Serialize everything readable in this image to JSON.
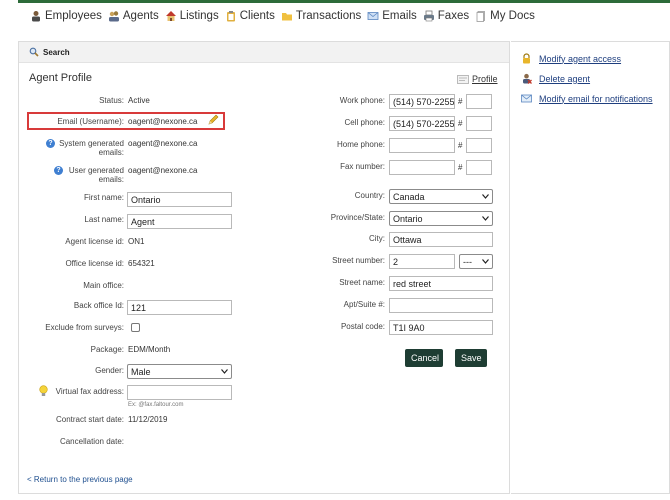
{
  "nav": {
    "items": [
      {
        "label": "Employees",
        "icon": "person-icon"
      },
      {
        "label": "Agents",
        "icon": "agents-icon"
      },
      {
        "label": "Listings",
        "icon": "house-icon"
      },
      {
        "label": "Clients",
        "icon": "clipboard-icon"
      },
      {
        "label": "Transactions",
        "icon": "folder-icon"
      },
      {
        "label": "Emails",
        "icon": "envelope-icon"
      },
      {
        "label": "Faxes",
        "icon": "fax-icon"
      },
      {
        "label": "My Docs",
        "icon": "document-icon"
      }
    ]
  },
  "search": {
    "label": "Search"
  },
  "profile": {
    "title": "Agent Profile",
    "profile_link": "Profile",
    "status_label": "Status:",
    "status_value": "Active",
    "email_label": "Email (Username):",
    "email_value": "oagent@nexone.ca",
    "sys_email_label": "System generated emails:",
    "sys_email_value": "oagent@nexone.ca",
    "user_email_label": "User generated emails:",
    "user_email_value": "oagent@nexone.ca",
    "first_name_label": "First name:",
    "first_name_value": "Ontario",
    "last_name_label": "Last name:",
    "last_name_value": "Agent",
    "agent_license_label": "Agent license id:",
    "agent_license_value": "ON1",
    "office_license_label": "Office license id:",
    "office_license_value": "654321",
    "main_office_label": "Main office:",
    "back_office_label": "Back office Id:",
    "back_office_value": "121",
    "exclude_label": "Exclude from surveys:",
    "package_label": "Package:",
    "package_value": "EDM/Month",
    "gender_label": "Gender:",
    "gender_value": "Male",
    "vfax_label": "Virtual fax address:",
    "vfax_value": "",
    "vfax_hint": "Ex: @fax.faltour.com",
    "contract_label": "Contract start date:",
    "contract_value": "11/12/2019",
    "cancel_date_label": "Cancellation date:"
  },
  "contact": {
    "work_label": "Work phone:",
    "work_value": "(514) 570-2255",
    "cell_label": "Cell phone:",
    "cell_value": "(514) 570-2255",
    "home_label": "Home phone:",
    "home_value": "",
    "fax_label": "Fax number:",
    "fax_value": "",
    "hash": "#",
    "country_label": "Country:",
    "country_value": "Canada",
    "province_label": "Province/State:",
    "province_value": "Ontario",
    "city_label": "City:",
    "city_value": "Ottawa",
    "street_number_label": "Street number:",
    "street_number_value": "2",
    "street_suffix_value": "---",
    "street_name_label": "Street name:",
    "street_name_value": "red street",
    "apt_label": "Apt/Suite #:",
    "apt_value": "",
    "postal_label": "Postal code:",
    "postal_value": "T1I 9A0"
  },
  "buttons": {
    "cancel": "Cancel",
    "save": "Save"
  },
  "back_link": "< Return to the previous page",
  "side": {
    "items": [
      {
        "label": "Modify agent access",
        "icon": "lock-icon"
      },
      {
        "label": "Delete agent",
        "icon": "user-delete-icon"
      },
      {
        "label": "Modify email for notifications",
        "icon": "envelope-icon"
      }
    ]
  },
  "colors": {
    "accent": "#2d6b3a",
    "button": "#1e3d33",
    "highlight": "#d83a3a",
    "link": "#1f3f7f"
  }
}
